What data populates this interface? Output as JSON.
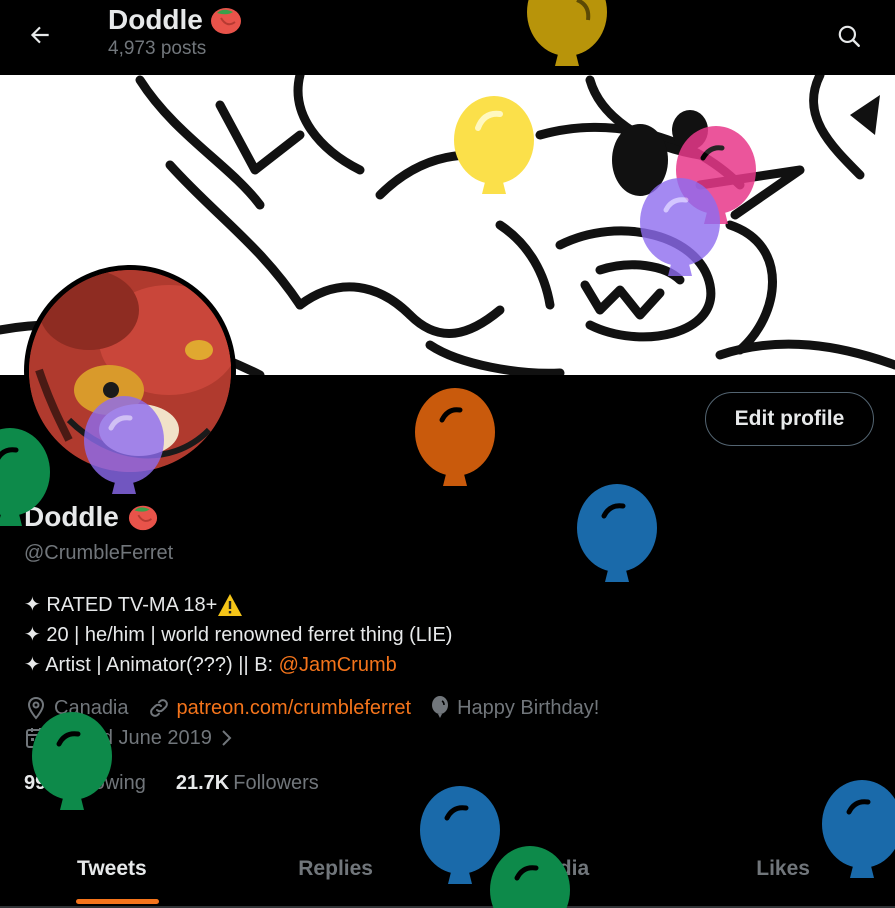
{
  "header": {
    "back_icon": "arrow-left-icon",
    "title": "Doddle",
    "posts_count": "4,973 posts",
    "search_icon": "search-icon"
  },
  "profile": {
    "name": "Doddle",
    "handle": "@CrumbleFerret",
    "edit_button": "Edit profile",
    "bio_lines": [
      {
        "text": "✦ RATED TV-MA 18+",
        "emoji": "warning"
      },
      {
        "text": "✦ 20 | he/him | world renowned ferret thing (LIE)"
      },
      {
        "text": "✦ Artist | Animator(???) || B: ",
        "link": "@JamCrumb"
      }
    ],
    "location": "Canadia",
    "website": "patreon.com/crumbleferret",
    "birthday": "Happy Birthday!",
    "joined": "Joined June 2019",
    "following_count": "997",
    "following_label": "Following",
    "followers_count": "21.7K",
    "followers_label": "Followers"
  },
  "tabs": [
    {
      "label": "Tweets",
      "active": true
    },
    {
      "label": "Replies",
      "active": false
    },
    {
      "label": "Media",
      "active": false
    },
    {
      "label": "Likes",
      "active": false
    }
  ],
  "colors": {
    "accent": "#f4741b",
    "muted": "#71767b",
    "text": "#e7e9ea",
    "background": "#000000"
  }
}
